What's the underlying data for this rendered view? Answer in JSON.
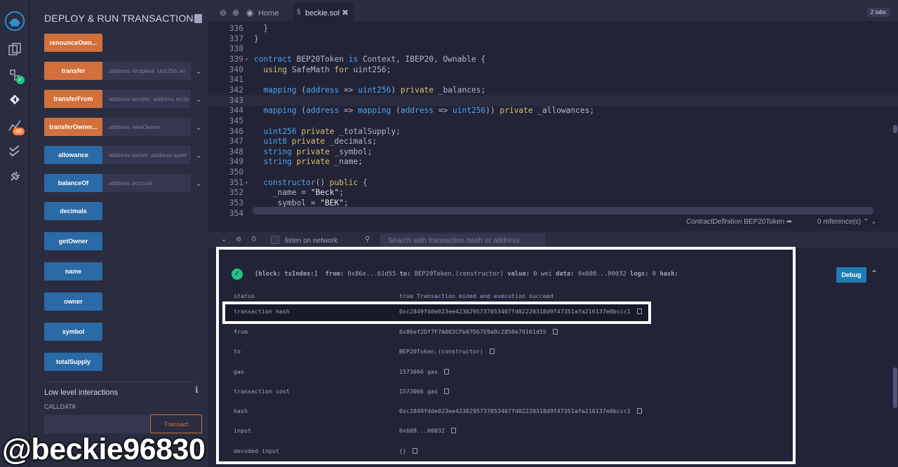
{
  "panel": {
    "title": "DEPLOY & RUN TRANSACTIONS",
    "functions": [
      {
        "label": "renounceOwn...",
        "kind": "orange",
        "placeholder": ""
      },
      {
        "label": "transfer",
        "kind": "orange",
        "placeholder": "address recipient, uint256 an"
      },
      {
        "label": "transferFrom",
        "kind": "orange",
        "placeholder": "address sender, address recip"
      },
      {
        "label": "transferOwner...",
        "kind": "orange",
        "placeholder": "address newOwner"
      },
      {
        "label": "allowance",
        "kind": "blue",
        "placeholder": "address owner, address spen"
      },
      {
        "label": "balanceOf",
        "kind": "blue",
        "placeholder": "address account"
      },
      {
        "label": "decimals",
        "kind": "blue",
        "placeholder": ""
      },
      {
        "label": "getOwner",
        "kind": "blue",
        "placeholder": ""
      },
      {
        "label": "name",
        "kind": "blue",
        "placeholder": ""
      },
      {
        "label": "owner",
        "kind": "blue",
        "placeholder": ""
      },
      {
        "label": "symbol",
        "kind": "blue",
        "placeholder": ""
      },
      {
        "label": "totalSupply",
        "kind": "blue",
        "placeholder": ""
      }
    ],
    "lowlevel_title": "Low level interactions",
    "lowlevel_info": "i",
    "calldata_label": "CALLDATA",
    "transact_label": "Transact"
  },
  "rail": {
    "badge": "48",
    "check": "✓"
  },
  "tabs": {
    "home_label": "Home",
    "file_label": "beckie.sol",
    "close_icon": "✖",
    "count": "2 tabs"
  },
  "editor": {
    "lines": [
      {
        "n": "336",
        "html": "  }"
      },
      {
        "n": "337",
        "html": "}"
      },
      {
        "n": "338",
        "html": ""
      },
      {
        "n": "339",
        "fold": true,
        "html": "<span class='ty'>contract</span> BEP20Token <span class='ty'>is</span> Context, IBEP20, Ownable {"
      },
      {
        "n": "340",
        "html": "  <span class='kw'>using</span> SafeMath <span class='kw'>for</span> uint256;"
      },
      {
        "n": "341",
        "html": ""
      },
      {
        "n": "342",
        "html": "  <span class='ty'>mapping</span> (<span class='ty'>address</span> => <span class='ty'>uint256</span>) <span class='kw'>private</span> _balances;"
      },
      {
        "n": "343",
        "cur": true,
        "html": ""
      },
      {
        "n": "344",
        "html": "  <span class='ty'>mapping</span> (<span class='ty'>address</span> => <span class='ty'>mapping</span> (<span class='ty'>address</span> => <span class='ty'>uint256</span>)) <span class='kw'>private</span> _allowances;"
      },
      {
        "n": "345",
        "html": ""
      },
      {
        "n": "346",
        "html": "  <span class='ty'>uint256</span> <span class='kw'>private</span> _totalSupply;"
      },
      {
        "n": "347",
        "html": "  <span class='ty'>uint8</span> <span class='kw'>private</span> _decimals;"
      },
      {
        "n": "348",
        "html": "  <span class='ty'>string</span> <span class='kw'>private</span> _symbol;"
      },
      {
        "n": "349",
        "html": "  <span class='ty'>string</span> <span class='kw'>private</span> _name;"
      },
      {
        "n": "350",
        "html": ""
      },
      {
        "n": "351",
        "fold": true,
        "html": "  <span class='ty'>constructor</span>() <span class='kw'>public</span> {"
      },
      {
        "n": "352",
        "html": "    _name = <span class='str'>\"Beck\"</span>;"
      },
      {
        "n": "353",
        "html": "    _symbol = <span class='str'>\"BEK\"</span>;"
      },
      {
        "n": "354",
        "html": ""
      }
    ]
  },
  "status": {
    "contract_def_prefix": "ContractDefinition",
    "contract_def_name": "BEP20Token",
    "references": "0 reference(s)"
  },
  "terminal": {
    "count": "0",
    "listen_label": "listen on network",
    "search_placeholder": "Search with transaction hash or address",
    "summary": {
      "block": "[block: txIndex:]",
      "from_label": "from:",
      "from_val": "0x86e...61d55",
      "to_label": "to:",
      "to_val": "BEP20Token.(constructor)",
      "value_label": "value:",
      "value_val": "0 wei",
      "data_label": "data:",
      "data_val": "0x608...00032",
      "logs_label": "logs:",
      "logs_val": "0",
      "hash_label": "hash:"
    },
    "debug_label": "Debug",
    "rows": [
      {
        "key": "status",
        "value": "true Transaction mined and execution succeed",
        "copy": false
      },
      {
        "key": "transaction hash",
        "value": "0xc2849fdde023ee4230295737053407fd02220318d9f47351afa216137e0bccc1",
        "copy": true
      },
      {
        "key": "from",
        "value": "0x86ef2Df7F7A003CFb07D67E9a9c2850e79161d55",
        "copy": true
      },
      {
        "key": "to",
        "value": "BEP20Token.(constructor)",
        "copy": true
      },
      {
        "key": "gas",
        "value": "1573066 gas",
        "copy": true
      },
      {
        "key": "transaction cost",
        "value": "1573066 gas",
        "copy": true
      },
      {
        "key": "hash",
        "value": "0xc2849fdde023ee4230295737053407fd02220318d9f47351afa216137e0bccc1",
        "copy": true
      },
      {
        "key": "input",
        "value": "0x608...00032",
        "copy": true
      },
      {
        "key": "decoded input",
        "value": "{}",
        "copy": true
      }
    ]
  },
  "watermark": "@beckie96830",
  "colors": {
    "orange": "#d2703c",
    "blue": "#2a6aa6",
    "success": "#1ec586",
    "debug": "#1e7eb3"
  }
}
